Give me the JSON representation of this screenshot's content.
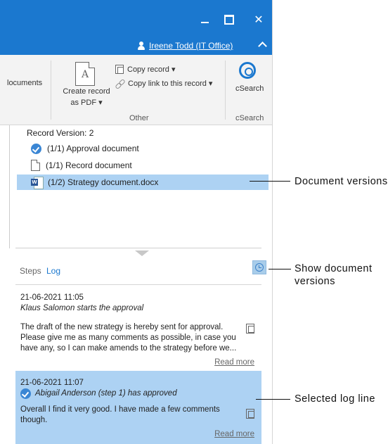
{
  "titlebar": {
    "username": "Ireene Todd (IT Office)",
    "min_label": "",
    "max_label": "",
    "close_label": "✕"
  },
  "ribbon": {
    "documents_partial": "locuments",
    "create_pdf": "Create record as PDF ▾",
    "copy_record": "Copy record ▾",
    "copy_link": "Copy link to this record ▾",
    "other_group": "Other",
    "csearch_label": "cSearch",
    "csearch_group": "cSearch"
  },
  "versions": {
    "title": "Record Version: 2",
    "items": [
      {
        "label": "(1/1) Approval document",
        "icon": "check-circle-icon"
      },
      {
        "label": "(1/1) Record document",
        "icon": "document-icon"
      },
      {
        "label": "(1/2) Strategy document.docx",
        "icon": "word-document-icon",
        "selected": true
      }
    ]
  },
  "tabs": {
    "steps": "Steps",
    "log": "Log"
  },
  "log": [
    {
      "date": "21-06-2021 11:05",
      "actor": "Klaus Salomon starts the approval",
      "message": "The draft of the new strategy is hereby sent for approval. Please give me as many comments as possible, in case you have any, so I can make amends to the strategy before we...",
      "read_more": "Read more"
    },
    {
      "date": "21-06-2021 11:07",
      "actor": "Abigail Anderson (step 1) has approved",
      "message": "Overall I find it very good. I have made a few comments though.",
      "read_more": "Read more",
      "selected": true
    }
  ],
  "callouts": {
    "document_versions": "Document versions",
    "show_document_versions": "Show document versions",
    "selected_log_line": "Selected log line"
  },
  "colors": {
    "titlebar": "#1b78cf",
    "selection": "#add2f3",
    "accent": "#1b78cf"
  }
}
